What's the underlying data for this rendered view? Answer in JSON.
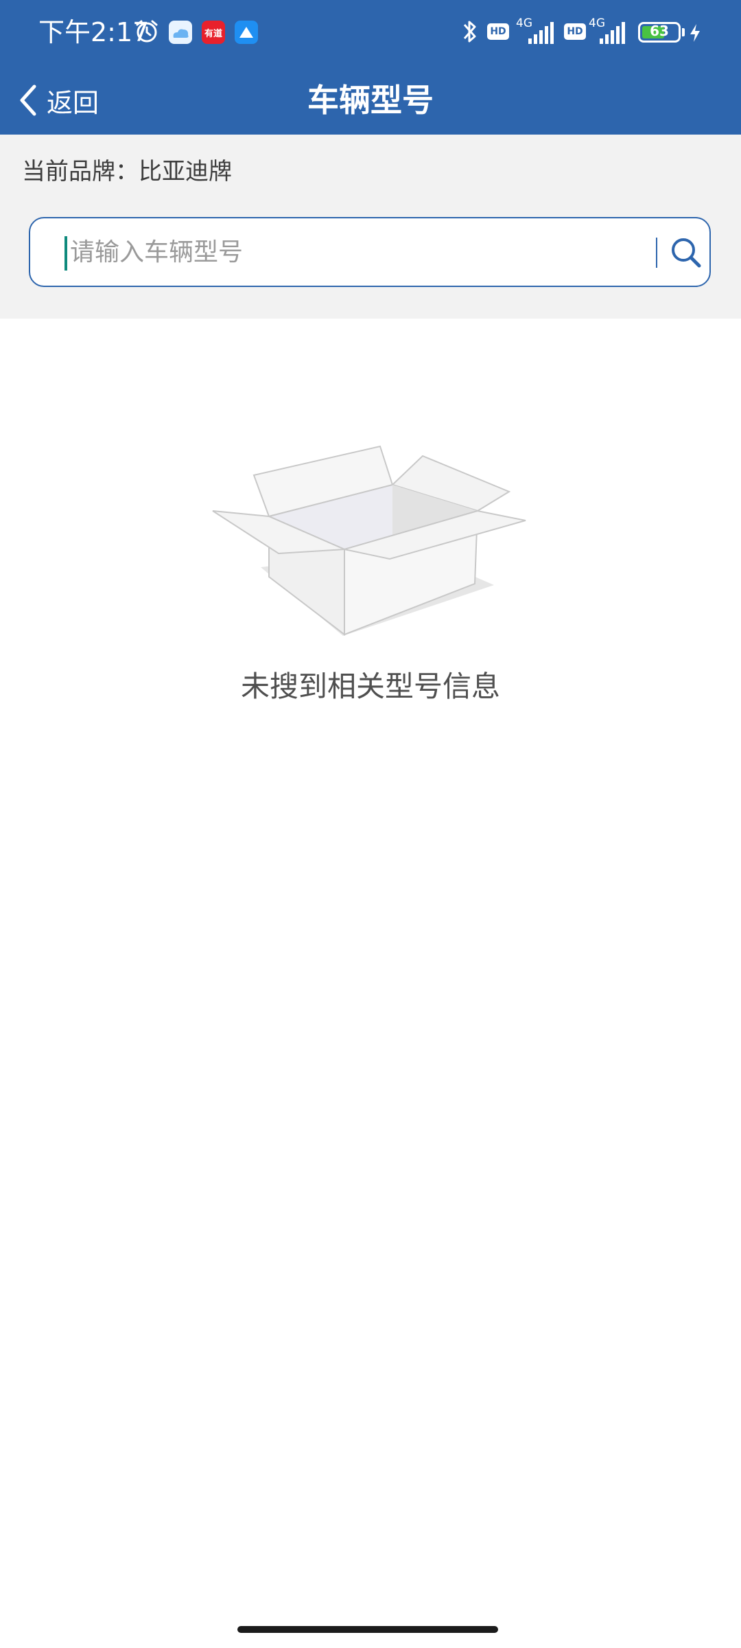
{
  "status_bar": {
    "time": "下午2:17",
    "network_1": "4G",
    "network_2": "4G",
    "hd_label": "HD",
    "battery_level": "63",
    "battery_fraction": 0.63,
    "app_icons": [
      "weather-app-icon",
      "youdao-app-icon",
      "blue-app-icon"
    ],
    "youdao_label": "有道"
  },
  "navbar": {
    "back_label": "返回",
    "title": "车辆型号"
  },
  "brand": {
    "current_brand_text": "当前品牌：比亚迪牌"
  },
  "search": {
    "placeholder": "请输入车辆型号",
    "value": ""
  },
  "empty_state": {
    "message": "未搜到相关型号信息",
    "icon": "empty-box-icon"
  },
  "colors": {
    "header_blue": "#2d65ad",
    "caret_teal": "#0f8a7d",
    "battery_green": "#49c243",
    "page_gray": "#f2f2f2"
  }
}
